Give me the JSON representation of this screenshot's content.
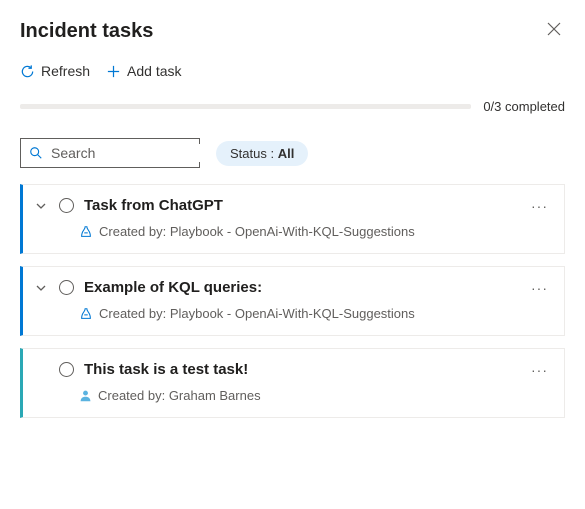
{
  "panel": {
    "title": "Incident tasks"
  },
  "toolbar": {
    "refresh_label": "Refresh",
    "add_task_label": "Add task"
  },
  "progress": {
    "text": "0/3 completed"
  },
  "filters": {
    "search_placeholder": "Search",
    "status_label": "Status : ",
    "status_value": "All"
  },
  "tasks": [
    {
      "title": "Task from ChatGPT",
      "created_by_label": "Created by: Playbook - OpenAi-With-KQL-Suggestions",
      "source": "playbook",
      "expandable": true,
      "accent": "blue"
    },
    {
      "title": "Example of KQL queries:",
      "created_by_label": "Created by: Playbook - OpenAi-With-KQL-Suggestions",
      "source": "playbook",
      "expandable": true,
      "accent": "blue"
    },
    {
      "title": "This task is a test task!",
      "created_by_label": "Created by: Graham Barnes",
      "source": "user",
      "expandable": false,
      "accent": "teal"
    }
  ]
}
